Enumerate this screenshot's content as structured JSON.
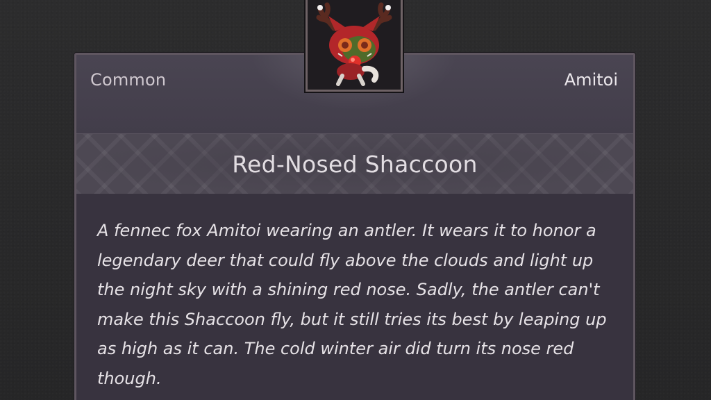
{
  "item": {
    "rarity": "Common",
    "category": "Amitoi",
    "name": "Red-Nosed Shaccoon",
    "icon": "red-nosed-shaccoon-icon",
    "description": "A fennec fox Amitoi wearing an antler. It wears it to honor a legendary deer that could fly above the clouds and light up the night sky with a shining red nose. Sadly, the antler can't make this Shaccoon fly, but it still tries its best by leaping up as high as it can. The cold winter air did turn its nose red though."
  },
  "colors": {
    "card_bg": "#3a3542",
    "title_text": "#e2dde2",
    "rarity_text": "#cfc8cf",
    "accent_nose": "#e0302a"
  }
}
